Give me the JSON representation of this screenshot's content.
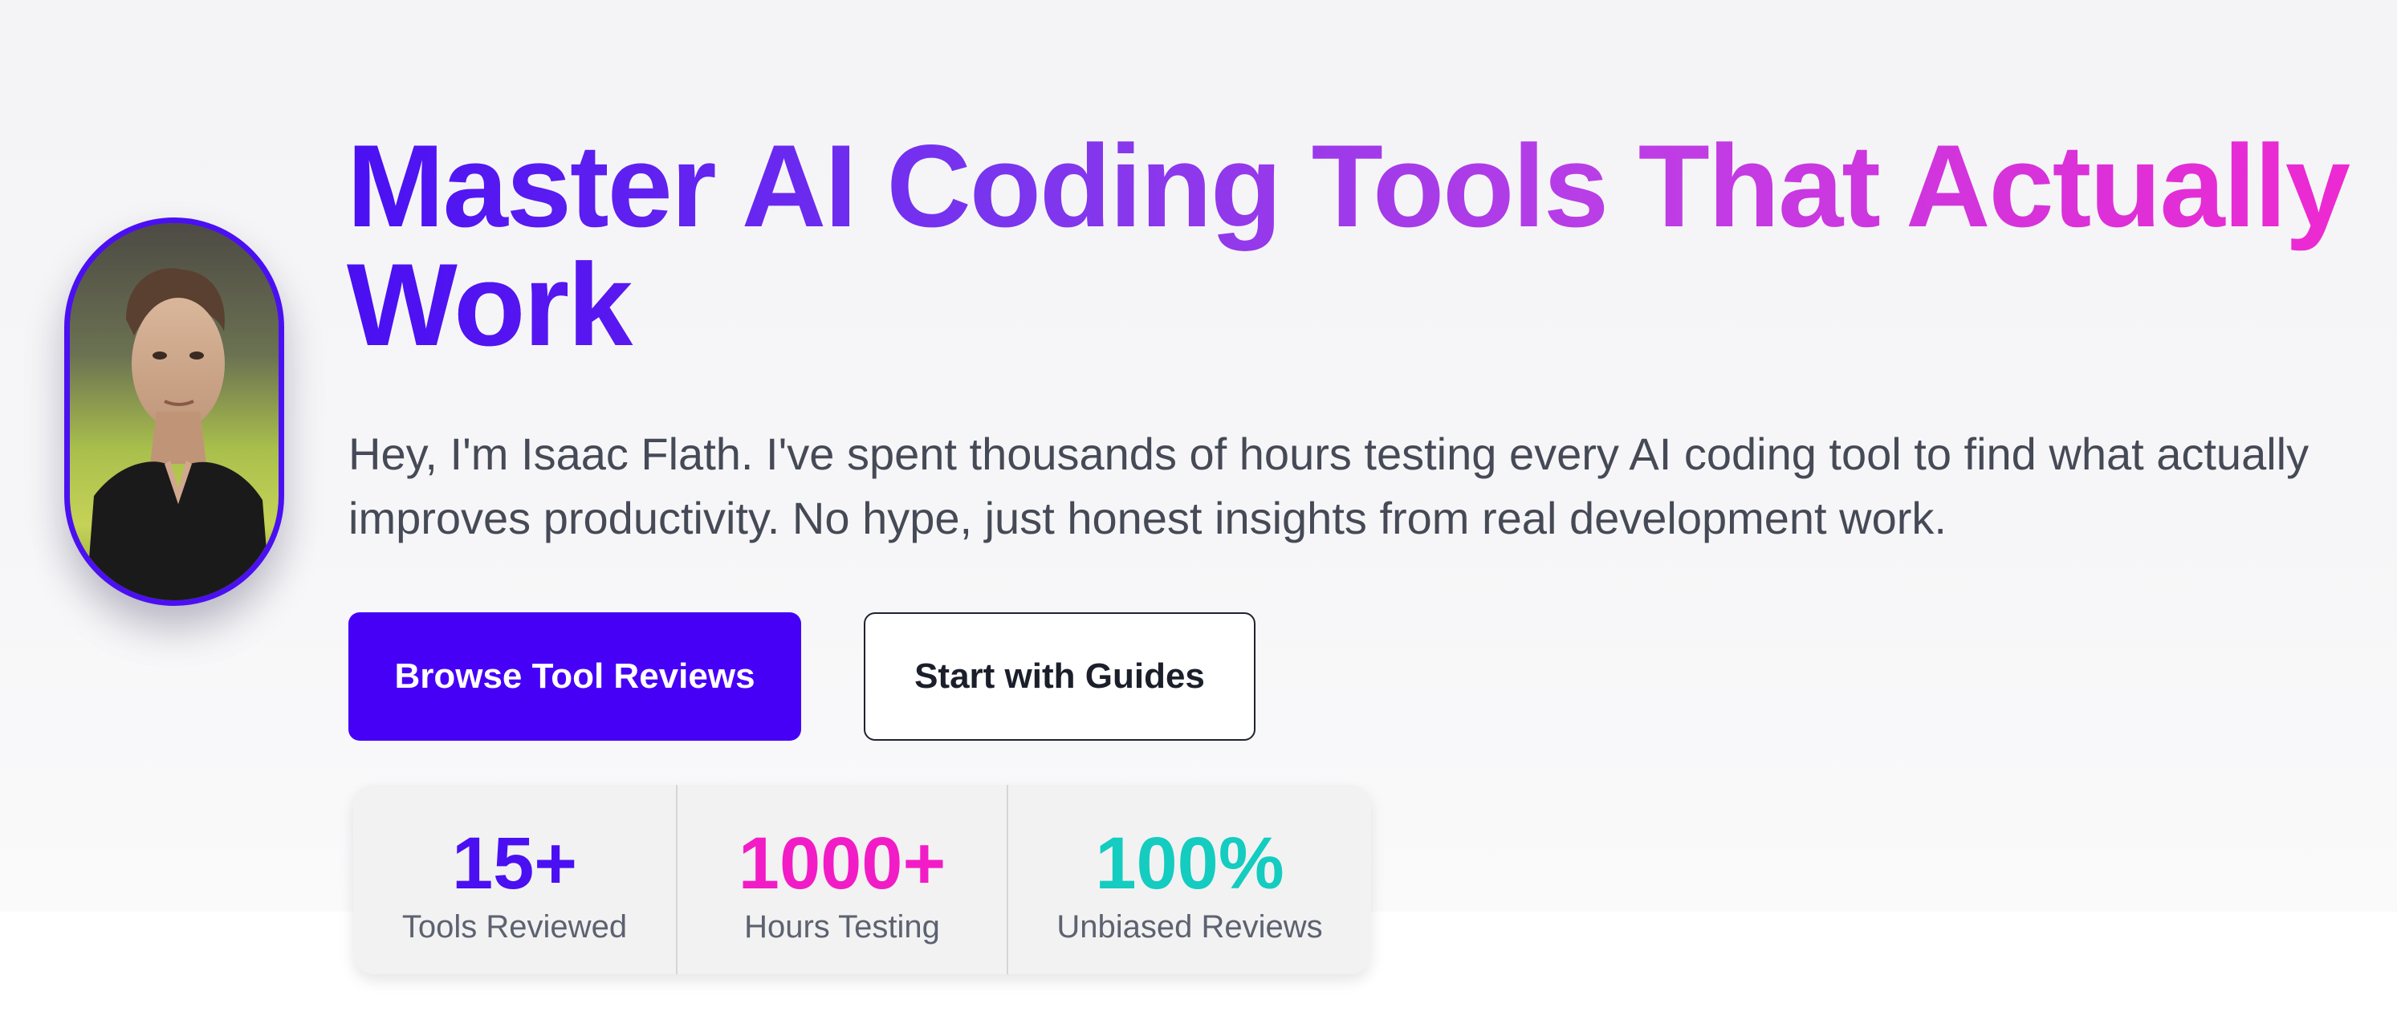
{
  "hero": {
    "headline": {
      "line1": "Master AI Coding Tools That Actually",
      "line2": "Work"
    },
    "intro_line1": "Hey, I'm Isaac Flath. I've spent thousands of hours testing every AI coding tool to find what actually",
    "intro_line2": "improves productivity. No hype, just honest insights from real development work.",
    "avatar_icon": "person-portrait",
    "buttons": {
      "primary_label": "Browse Tool Reviews",
      "secondary_label": "Start with Guides"
    }
  },
  "stats": [
    {
      "value": "15+",
      "label": "Tools Reviewed",
      "color": "#4a10f2"
    },
    {
      "value": "1000+",
      "label": "Hours Testing",
      "color": "#f21cc6"
    },
    {
      "value": "100%",
      "label": "Unbiased Reviews",
      "color": "#14ccbf"
    }
  ],
  "colors": {
    "accent": "#4600f6",
    "gradient_start": "#4a10f2",
    "gradient_end": "#f028d0",
    "text_body": "#454a56"
  }
}
